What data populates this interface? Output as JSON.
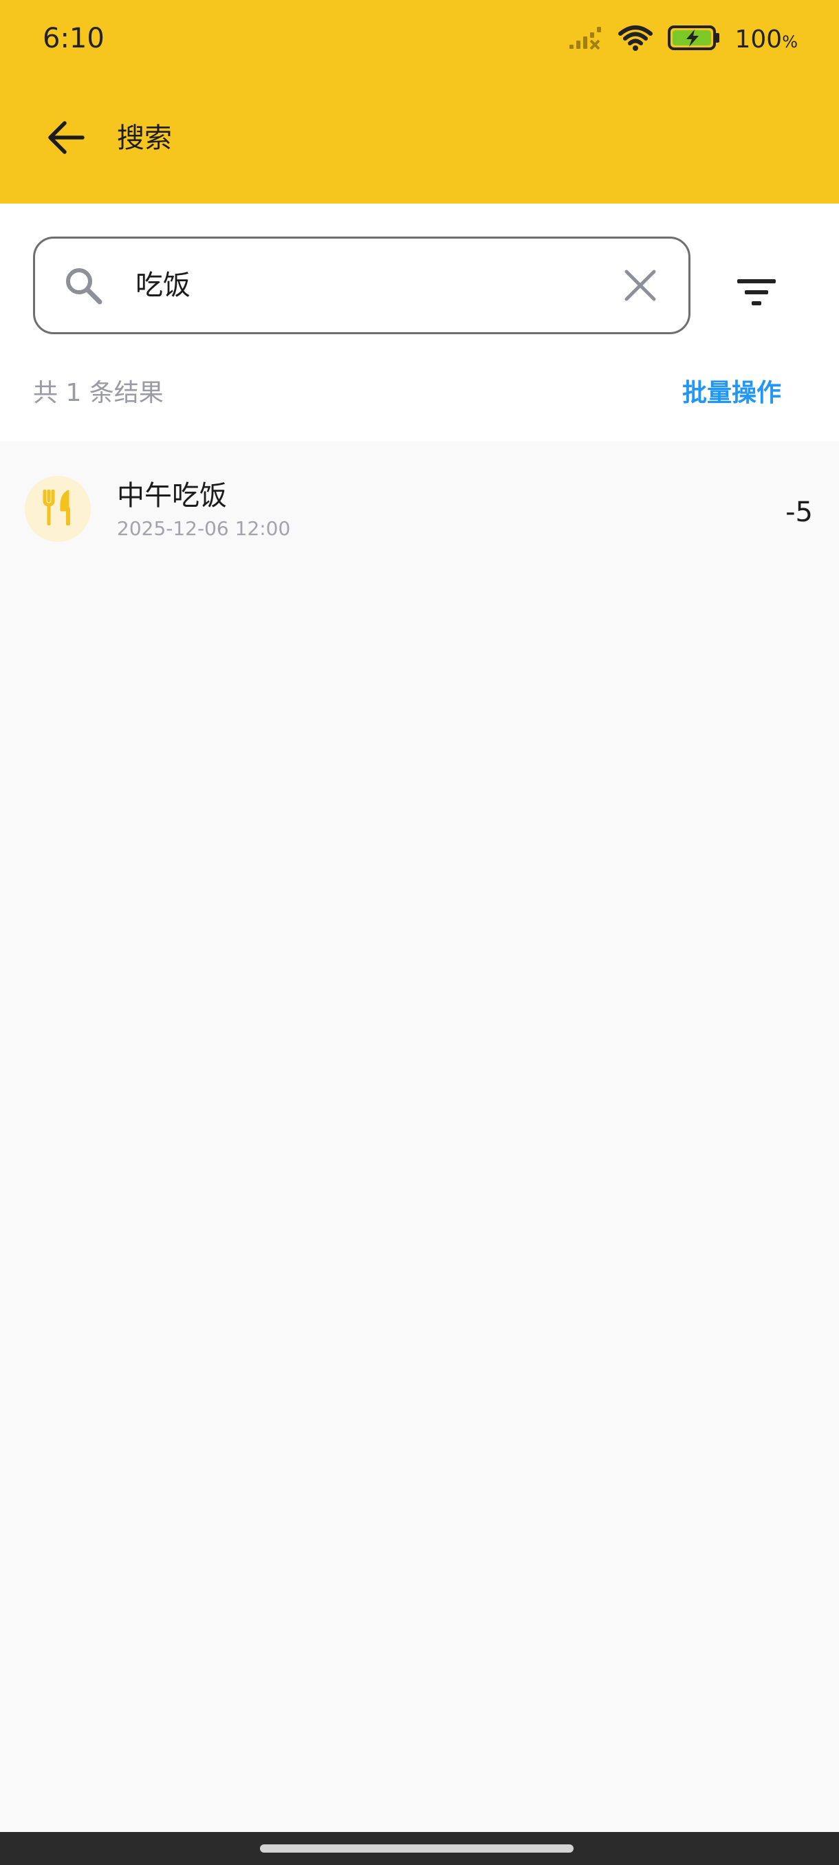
{
  "status_bar": {
    "time": "6:10",
    "battery_level": "100",
    "battery_unit": "%",
    "icons": [
      "signal-icon",
      "wifi-icon",
      "battery-charging-icon"
    ]
  },
  "app_bar": {
    "title": "搜索",
    "back_icon": "arrow-left-icon"
  },
  "search": {
    "value": "吃饭",
    "search_icon": "search-icon",
    "clear_icon": "close-icon",
    "filter_icon": "filter-icon"
  },
  "results": {
    "count_text": "共 1 条结果",
    "batch_label": "批量操作"
  },
  "list": {
    "items": [
      {
        "title": "中午吃饭",
        "date": "2025-12-06 12:00",
        "amount": "-5",
        "icon": "utensils-icon"
      }
    ]
  },
  "colors": {
    "header_yellow": "#f7c61e",
    "accent_blue": "#2196f3",
    "avatar_bg": "#fdf3d3",
    "icon_yellow": "#f4c21f"
  }
}
